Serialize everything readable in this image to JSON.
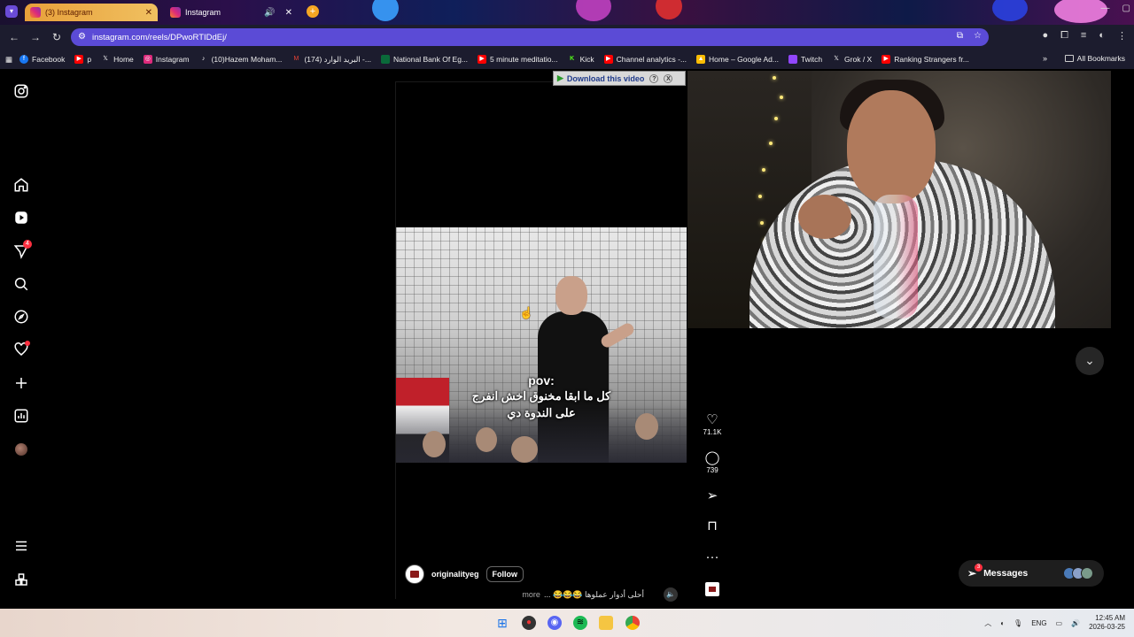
{
  "browser": {
    "tabs": [
      {
        "label": "(3) Instagram",
        "active": true
      },
      {
        "label": "Instagram",
        "active": false
      }
    ],
    "url": "instagram.com/reels/DPwoRTIDdEj/",
    "bookmarks": [
      {
        "label": "Facebook",
        "icon": "facebook-icon",
        "color": "#1877f2"
      },
      {
        "label": "p",
        "icon": "youtube-icon",
        "color": "#ff0000"
      },
      {
        "label": "Home",
        "icon": "x-icon",
        "color": "#000000"
      },
      {
        "label": "Instagram",
        "icon": "instagram-icon",
        "color": "#dd2a7b"
      },
      {
        "label": "(10)Hazem Moham...",
        "icon": "tiktok-icon",
        "color": "#111111"
      },
      {
        "label": "(174) البريد الوارد -...",
        "icon": "gmail-icon",
        "color": "#ea4335"
      },
      {
        "label": "National Bank Of Eg...",
        "icon": "bank-icon",
        "color": "#0a6a3a"
      },
      {
        "label": "5 minute meditatio...",
        "icon": "youtube-icon",
        "color": "#ff0000"
      },
      {
        "label": "Kick",
        "icon": "kick-icon",
        "color": "#53fc18"
      },
      {
        "label": "Channel analytics -...",
        "icon": "youtube-icon",
        "color": "#ff0000"
      },
      {
        "label": "Home – Google Ad...",
        "icon": "google-ads-icon",
        "color": "#fbbc04"
      },
      {
        "label": "Twitch",
        "icon": "twitch-icon",
        "color": "#9146ff"
      },
      {
        "label": "Grok / X",
        "icon": "x-icon",
        "color": "#000000"
      },
      {
        "label": "Ranking Strangers fr...",
        "icon": "youtube-icon",
        "color": "#ff0000"
      }
    ],
    "all_bookmarks": "All Bookmarks"
  },
  "leftnav": {
    "notifications_badge": "4"
  },
  "reel": {
    "overlay_pov": "pov:",
    "overlay_line1": "كل ما ابقا مخنوق اخش انفرج",
    "overlay_line2": "على الندوة دي",
    "author": "originalityeg",
    "follow_label": "Follow",
    "caption": "أحلى أدوار عملوها 😂😂😂 ...",
    "more_label": "more",
    "likes": "71.1K",
    "comments": "739"
  },
  "download_bar": {
    "label": "Download this video",
    "help": "?",
    "close": "X"
  },
  "messages": {
    "label": "Messages",
    "badge": "3"
  },
  "taskbar": {
    "language": "ENG",
    "time": "12:45 AM",
    "date": "2026-03-25"
  }
}
